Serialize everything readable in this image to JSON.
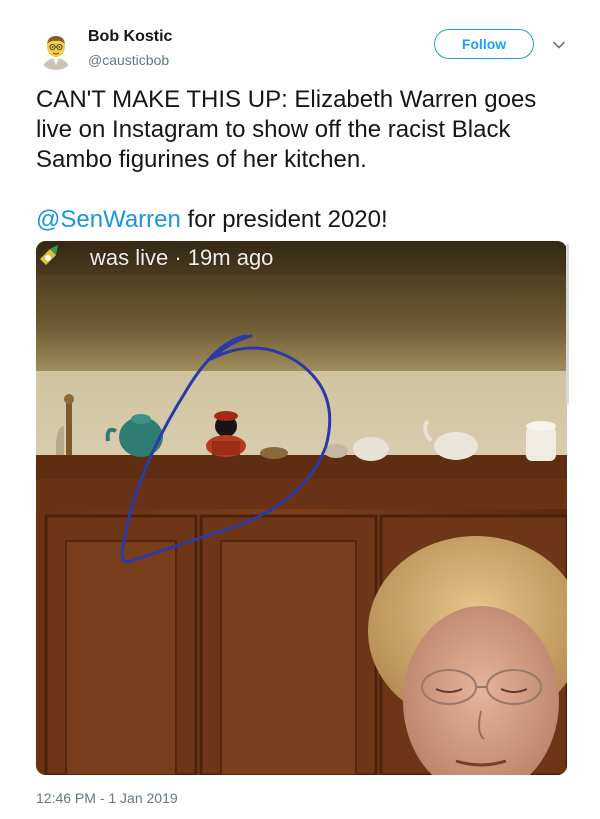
{
  "author": {
    "name": "Bob Kostic",
    "handle": "@causticbob",
    "avatar_icon": "cartoon-avatar-icon"
  },
  "actions": {
    "follow_label": "Follow",
    "menu_icon": "chevron-down-icon"
  },
  "tweet": {
    "text_line1": "CAN'T MAKE THIS UP: Elizabeth Warren goes live on Instagram to show off the racist Black Sambo figurines of her kitchen.",
    "mention": "@SenWarren",
    "text_line2_rest": " for president 2020!"
  },
  "media": {
    "overlay_text": "was live · 19m ago"
  },
  "timestamp": "12:46 PM - 1 Jan 2019",
  "colors": {
    "brand_blue": "#1da1f2",
    "link_blue": "#1b95e0",
    "secondary_text": "#657786",
    "annotation_circle": "#2a3aa8"
  }
}
